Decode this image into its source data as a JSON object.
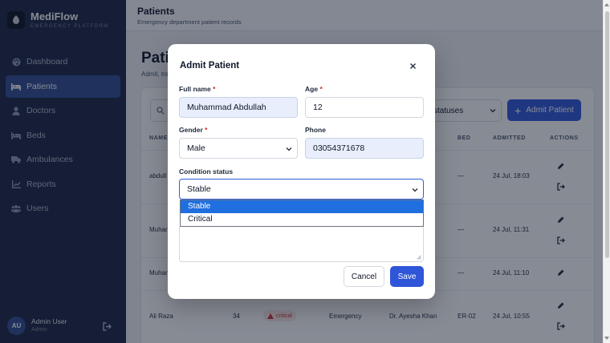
{
  "sidebar": {
    "brand_name": "MediFlow",
    "brand_sub": "EMERGENCY PLATFORM",
    "items": [
      {
        "label": "Dashboard",
        "icon": "palette-icon",
        "active": false
      },
      {
        "label": "Patients",
        "icon": "bed-icon",
        "active": true
      },
      {
        "label": "Doctors",
        "icon": "user-md-icon",
        "active": false
      },
      {
        "label": "Beds",
        "icon": "bed-icon",
        "active": false
      },
      {
        "label": "Ambulances",
        "icon": "truck-icon",
        "active": false
      },
      {
        "label": "Reports",
        "icon": "chart-line-icon",
        "active": false
      },
      {
        "label": "Users",
        "icon": "users-icon",
        "active": false
      }
    ],
    "user": {
      "initials": "AU",
      "name": "Admin User",
      "role": "Admin"
    }
  },
  "header": {
    "title": "Patients",
    "subtitle": "Emergency department patient records"
  },
  "main": {
    "page_title": "Patie",
    "page_subtitle": "Admit, tra",
    "status_filter": "statuses",
    "admit_button": "Admit Patient",
    "columns": [
      "NAME",
      "BED",
      "ADMITTED",
      "ACTIONS"
    ],
    "rows": [
      {
        "name": "abdull",
        "bed": "—",
        "admitted": "24 Jul, 18:03"
      },
      {
        "name": "Muhar",
        "bed": "—",
        "admitted": "24 Jul, 11:31"
      },
      {
        "name": "Muhar",
        "bed": "—",
        "admitted": "24 Jul, 11:10"
      },
      {
        "name": "Ali Raza",
        "age": "34",
        "condition": "critical",
        "department": "Emergency",
        "doctor": "Dr. Ayesha Khan",
        "bed": "ER-02",
        "admitted": "24 Jul, 10:55"
      }
    ]
  },
  "modal": {
    "title": "Admit Patient",
    "full_name_label": "Full name",
    "full_name_value": "Muhammad Abdullah",
    "age_label": "Age",
    "age_value": "12",
    "gender_label": "Gender",
    "gender_value": "Male",
    "phone_label": "Phone",
    "phone_value": "03054371678",
    "condition_label": "Condition status",
    "condition_value": "Stable",
    "condition_options": [
      "Stable",
      "Critical"
    ],
    "required_mark": "*",
    "cancel_label": "Cancel",
    "save_label": "Save"
  },
  "colors": {
    "sidebar_bg": "#1b2542",
    "active_nav": "#2f4b8e",
    "primary": "#2f56d8",
    "required": "#dc2626",
    "critical": "#d13434"
  }
}
